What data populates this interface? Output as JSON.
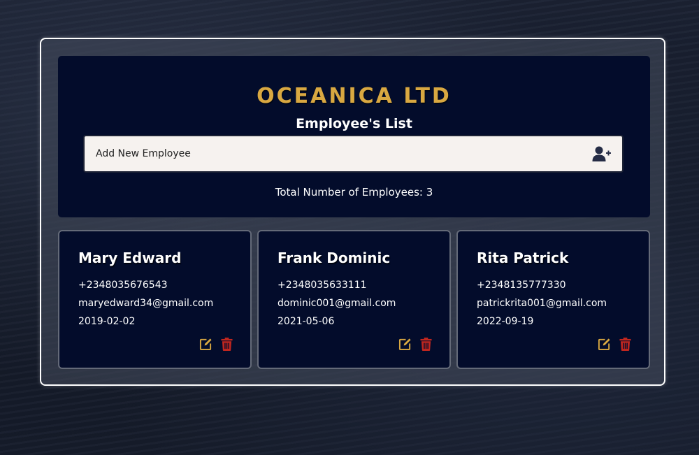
{
  "header": {
    "company": "OCEANICA LTD",
    "subtitle": "Employee's List"
  },
  "add_employee": {
    "placeholder": "Add New Employee",
    "icon": "user-plus-icon"
  },
  "total": {
    "text": "Total Number of Employees: 3",
    "count": 3
  },
  "colors": {
    "brand_gold": "#d9a841",
    "card_bg": "#030c2b",
    "edit_icon": "#d9a841",
    "delete_icon": "#c0261f"
  },
  "employees": [
    {
      "name": "Mary Edward",
      "phone": "+2348035676543",
      "email": "maryedward34@gmail.com",
      "date": "2019-02-02"
    },
    {
      "name": "Frank Dominic",
      "phone": "+2348035633111",
      "email": "dominic001@gmail.com",
      "date": "2021-05-06"
    },
    {
      "name": "Rita Patrick",
      "phone": "+2348135777330",
      "email": "patrickrita001@gmail.com",
      "date": "2022-09-19"
    }
  ],
  "card_icons": {
    "edit": "edit-icon",
    "delete": "trash-icon"
  }
}
